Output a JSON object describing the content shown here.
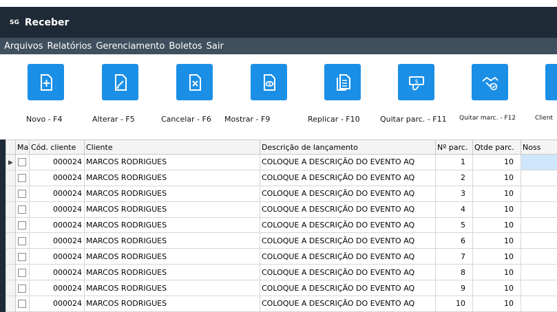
{
  "titlebar": {
    "logo": "SG",
    "title": "Receber"
  },
  "menu": [
    "Arquivos",
    "Relatórios",
    "Gerenciamento",
    "Boletos",
    "Sair"
  ],
  "toolbar": {
    "buttons": [
      {
        "label": "Novo - F4",
        "icon": "add-document-icon"
      },
      {
        "label": "Alterar - F5",
        "icon": "edit-document-icon"
      },
      {
        "label": "Cancelar - F6",
        "icon": "cancel-document-icon"
      },
      {
        "label": "Mostrar - F9",
        "icon": "view-document-icon"
      },
      {
        "label": "Replicar - F10",
        "icon": "copy-document-icon"
      },
      {
        "label": "Quitar parc. - F11",
        "icon": "pay-bill-icon"
      },
      {
        "label": "Quitar marc. - F12",
        "icon": "handshake-check-icon"
      },
      {
        "label": "Client",
        "icon": "client-icon"
      }
    ]
  },
  "grid": {
    "columns": [
      "Mar",
      "Cód. cliente",
      "Cliente",
      "Descrição de lançamento",
      "Nº parc.",
      "Qtde parc.",
      "Noss"
    ],
    "rows": [
      {
        "code": "000024",
        "client": "MARCOS RODRIGUES",
        "desc": "COLOQUE A DESCRIÇÃO DO EVENTO AQ",
        "parc": "1",
        "qtde": "10"
      },
      {
        "code": "000024",
        "client": "MARCOS RODRIGUES",
        "desc": "COLOQUE A DESCRIÇÃO DO EVENTO AQ",
        "parc": "2",
        "qtde": "10"
      },
      {
        "code": "000024",
        "client": "MARCOS RODRIGUES",
        "desc": "COLOQUE A DESCRIÇÃO DO EVENTO AQ",
        "parc": "3",
        "qtde": "10"
      },
      {
        "code": "000024",
        "client": "MARCOS RODRIGUES",
        "desc": "COLOQUE A DESCRIÇÃO DO EVENTO AQ",
        "parc": "4",
        "qtde": "10"
      },
      {
        "code": "000024",
        "client": "MARCOS RODRIGUES",
        "desc": "COLOQUE A DESCRIÇÃO DO EVENTO AQ",
        "parc": "5",
        "qtde": "10"
      },
      {
        "code": "000024",
        "client": "MARCOS RODRIGUES",
        "desc": "COLOQUE A DESCRIÇÃO DO EVENTO AQ",
        "parc": "6",
        "qtde": "10"
      },
      {
        "code": "000024",
        "client": "MARCOS RODRIGUES",
        "desc": "COLOQUE A DESCRIÇÃO DO EVENTO AQ",
        "parc": "7",
        "qtde": "10"
      },
      {
        "code": "000024",
        "client": "MARCOS RODRIGUES",
        "desc": "COLOQUE A DESCRIÇÃO DO EVENTO AQ",
        "parc": "8",
        "qtde": "10"
      },
      {
        "code": "000024",
        "client": "MARCOS RODRIGUES",
        "desc": "COLOQUE A DESCRIÇÃO DO EVENTO AQ",
        "parc": "9",
        "qtde": "10"
      },
      {
        "code": "000024",
        "client": "MARCOS RODRIGUES",
        "desc": "COLOQUE A DESCRIÇÃO DO EVENTO AQ",
        "parc": "10",
        "qtde": "10"
      }
    ]
  },
  "colors": {
    "titlebar": "#1e2a35",
    "menubar": "#3f4f5e",
    "accent": "#1b8fe6",
    "selection": "#cde6fb"
  }
}
